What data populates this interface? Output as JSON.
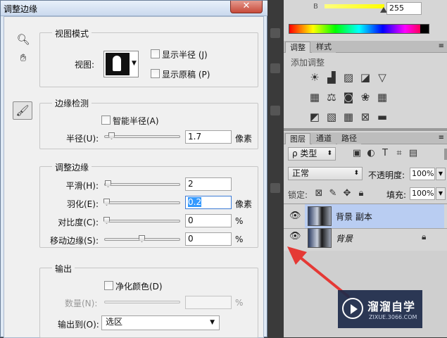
{
  "dialog": {
    "title": "调整边缘",
    "close_label": "✕",
    "view_mode": {
      "legend": "视图模式",
      "view_label": "视图:",
      "show_radius_label": "显示半径 (J)",
      "show_original_label": "显示原稿 (P)"
    },
    "edge_detection": {
      "legend": "边缘检测",
      "smart_radius_label": "智能半径(A)",
      "radius_label": "半径(U):",
      "radius_value": "1.7",
      "radius_unit": "像素",
      "radius_level": 0.05
    },
    "adjust_edge": {
      "legend": "调整边缘",
      "rows": [
        {
          "label": "平滑(H):",
          "value": "2",
          "unit": "",
          "level": 0.02
        },
        {
          "label": "羽化(E):",
          "value": "0.2",
          "unit": "像素",
          "level": 0.0
        },
        {
          "label": "对比度(C):",
          "value": "0",
          "unit": "%",
          "level": 0.0
        },
        {
          "label": "移动边缘(S):",
          "value": "0",
          "unit": "%",
          "level": 0.5
        }
      ]
    },
    "output": {
      "legend": "输出",
      "decontaminate_label": "净化颜色(D)",
      "amount_label": "数量(N):",
      "amount_unit": "%",
      "output_to_label": "输出到(O):",
      "output_to_value": "选区"
    }
  },
  "panel": {
    "color_b_label": "B",
    "color_b_value": "255",
    "adjust_tabs": [
      "调整",
      "样式"
    ],
    "add_adjustment": "添加调整",
    "layer_tabs": [
      "图层",
      "通道",
      "路径"
    ],
    "kind_filter": "ρ 类型",
    "blend_mode": "正常",
    "opacity_label": "不透明度:",
    "opacity_value": "100%",
    "lock_label": "锁定:",
    "fill_label": "填充:",
    "fill_value": "100%",
    "layers": [
      {
        "name": "背景 副本",
        "selected": true
      },
      {
        "name": "背景",
        "selected": false
      }
    ]
  },
  "watermark": {
    "brand": "溜溜自学",
    "site": "ZIXUE.3066.COM"
  },
  "colors": {
    "layer_selected": "#b9cdf2",
    "annotation_arrow": "#e53935",
    "watermark_bg": "#1e2b4a"
  }
}
